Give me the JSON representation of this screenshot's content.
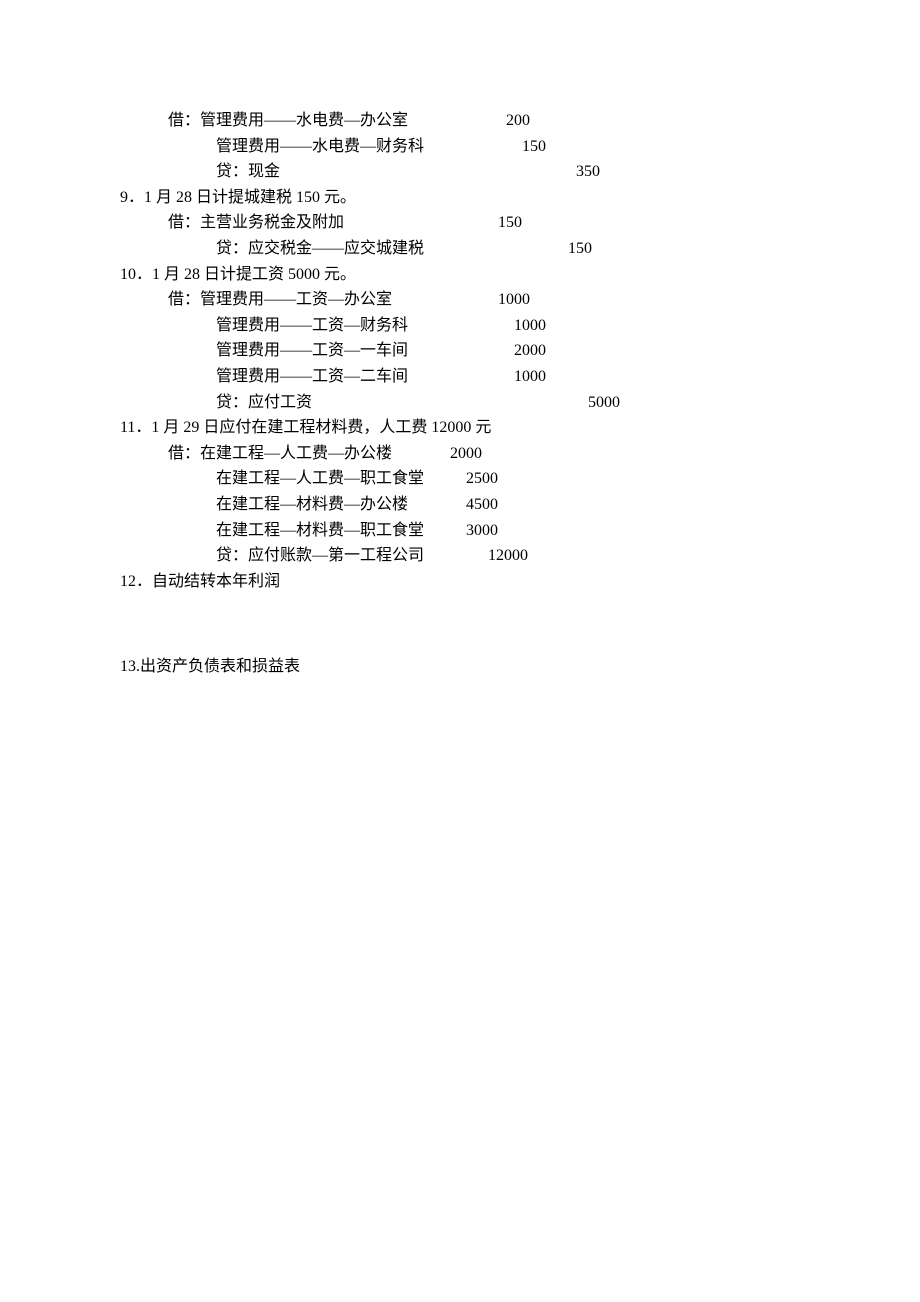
{
  "entry8": {
    "dr_label": "借：",
    "dr1_acc": "管理费用——水电费—办公室",
    "dr1_amt": "200",
    "dr2_acc": "管理费用——水电费—财务科",
    "dr2_amt": "150",
    "cr_label": "贷：",
    "cr_acc": "现金",
    "cr_amt": "350"
  },
  "entry9": {
    "num": "9．",
    "title": "1 月 28 日计提城建税 150 元。",
    "dr_label": "借：",
    "dr_acc": "主营业务税金及附加",
    "dr_amt": "150",
    "cr_label": "贷：",
    "cr_acc": "应交税金——应交城建税",
    "cr_amt": "150"
  },
  "entry10": {
    "num": "10．",
    "title": "1 月 28 日计提工资 5000 元。",
    "dr_label": "借：",
    "dr1_acc": "管理费用——工资—办公室",
    "dr1_amt": "1000",
    "dr2_acc": "管理费用——工资—财务科",
    "dr2_amt": "1000",
    "dr3_acc": "管理费用——工资—一车间",
    "dr3_amt": "2000",
    "dr4_acc": "管理费用——工资—二车间",
    "dr4_amt": "1000",
    "cr_label": "贷：",
    "cr_acc": "应付工资",
    "cr_amt": "5000"
  },
  "entry11": {
    "num": "11．",
    "title": "1 月 29 日应付在建工程材料费，人工费 12000 元",
    "dr_label": "借：",
    "dr1_acc": "在建工程—人工费—办公楼",
    "dr1_amt": "2000",
    "dr2_acc": "在建工程—人工费—职工食堂",
    "dr2_amt": "2500",
    "dr3_acc": "在建工程—材料费—办公楼",
    "dr3_amt": "4500",
    "dr4_acc": "在建工程—材料费—职工食堂",
    "dr4_amt": "3000",
    "cr_label": "贷：",
    "cr_acc": "应付账款—第一工程公司",
    "cr_amt": "12000"
  },
  "entry12": {
    "num": "12．",
    "title": "自动结转本年利润"
  },
  "entry13": {
    "num": "13.",
    "title": "出资产负债表和损益表"
  }
}
